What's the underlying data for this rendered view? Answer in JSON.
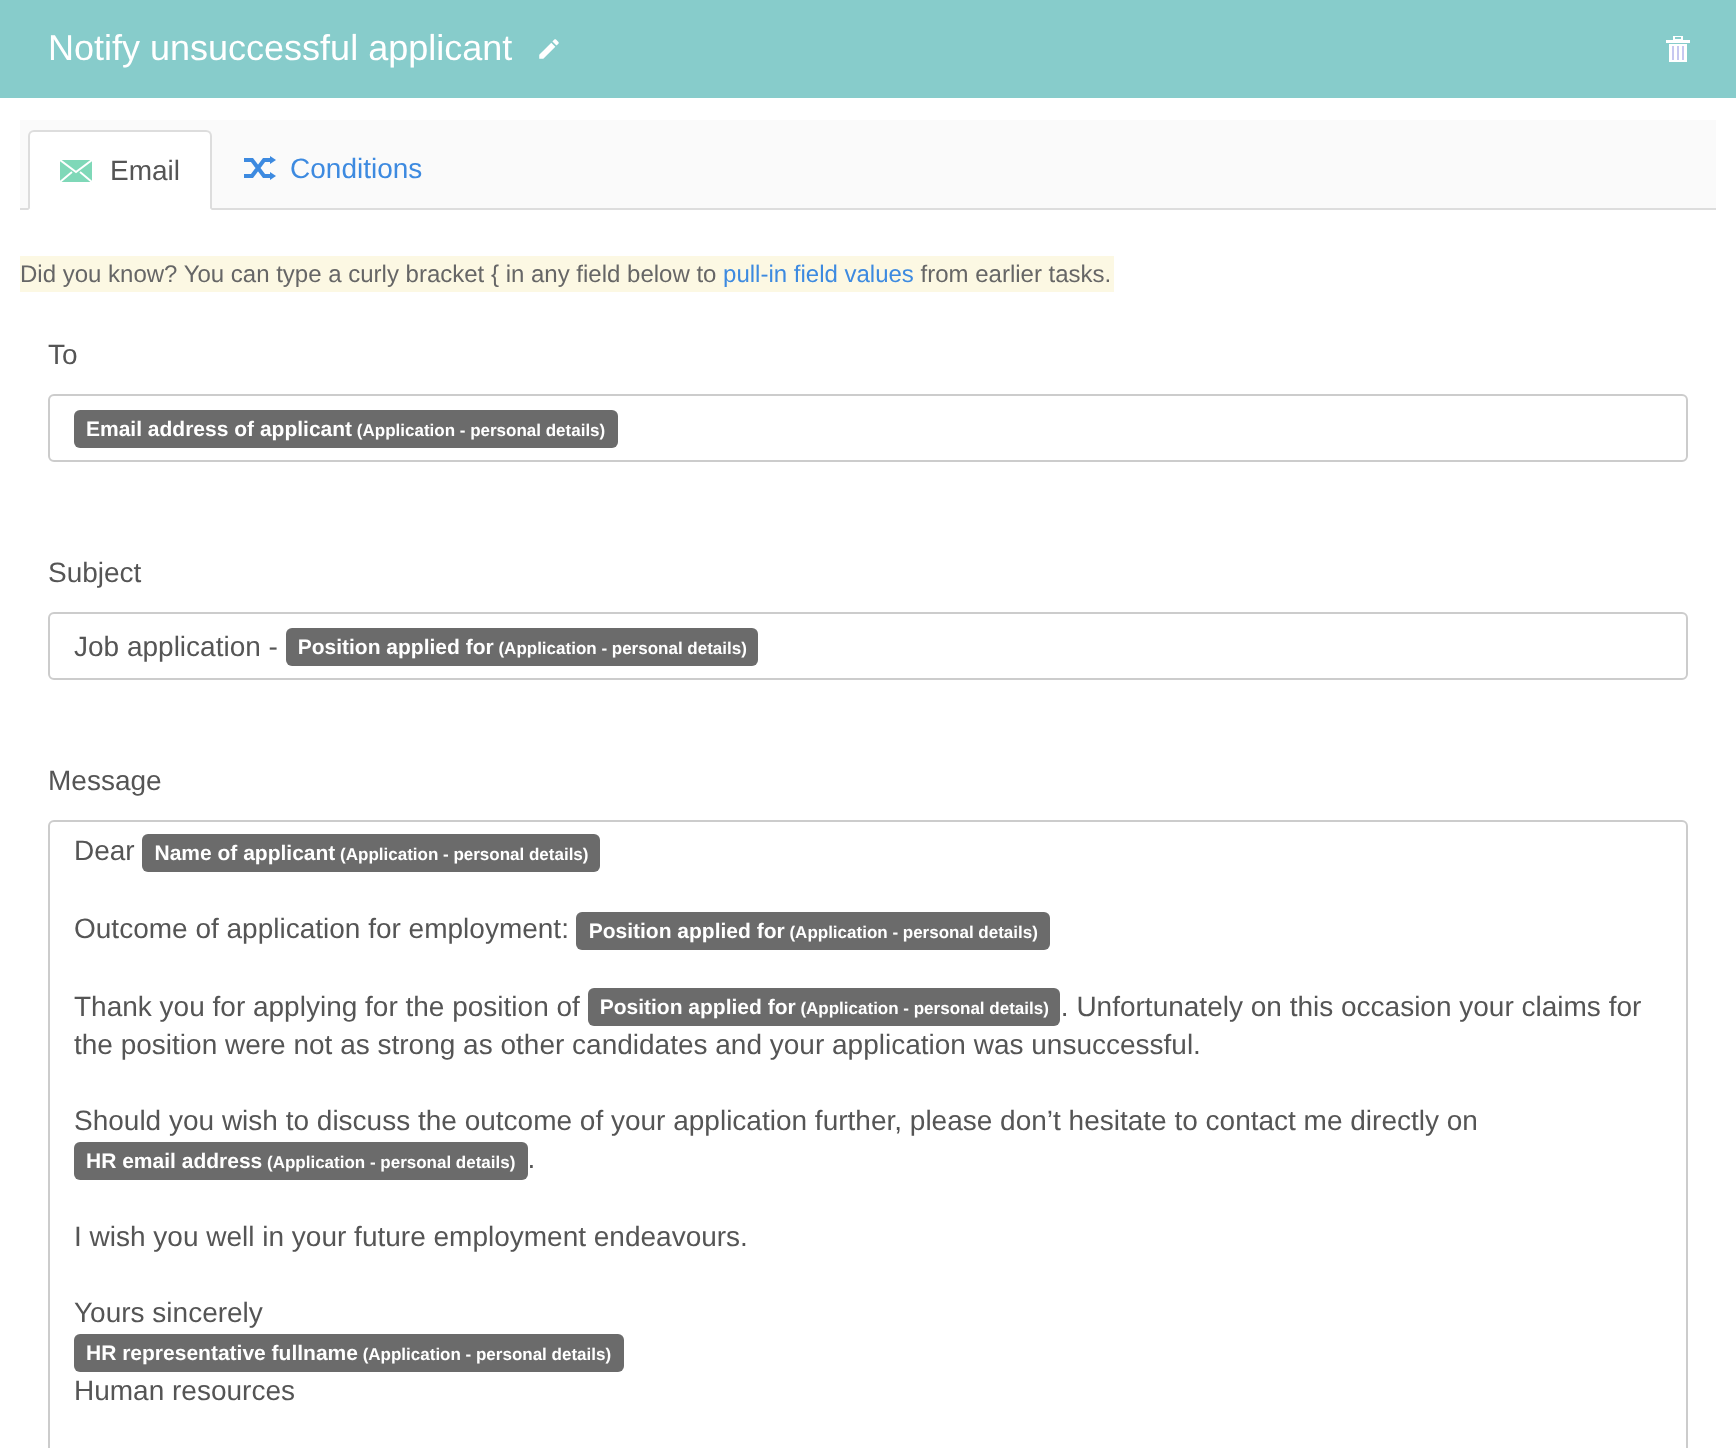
{
  "header": {
    "title": "Notify unsuccessful applicant"
  },
  "tabs": [
    {
      "label": "Email",
      "selected": true
    },
    {
      "label": "Conditions",
      "selected": false
    }
  ],
  "hint": {
    "before": "Did you know? You can type a curly bracket { in any field below to ",
    "link": "pull-in field values",
    "after": " from earlier tasks."
  },
  "fields": [
    {
      "label": "To",
      "segments": [
        {
          "kind": "token",
          "field": "Email address of applicant",
          "source": "(Application - personal details)"
        }
      ]
    },
    {
      "label": "Subject",
      "segments": [
        {
          "kind": "text",
          "text": "Job application - "
        },
        {
          "kind": "token",
          "field": "Position applied for",
          "source": "(Application - personal details)"
        }
      ]
    }
  ],
  "message": {
    "label": "Message",
    "paragraphs": [
      {
        "lines": [
          [
            {
              "kind": "text",
              "text": "Dear "
            },
            {
              "kind": "token",
              "field": "Name of applicant",
              "source": "(Application - personal details)"
            }
          ]
        ]
      },
      {
        "lines": [
          [
            {
              "kind": "text",
              "text": "Outcome of application for employment: "
            },
            {
              "kind": "token",
              "field": "Position applied for",
              "source": "(Application - personal details)"
            }
          ]
        ]
      },
      {
        "lines": [
          [
            {
              "kind": "text",
              "text": "Thank you for applying for the position of "
            },
            {
              "kind": "token",
              "field": "Position applied for",
              "source": "(Application - personal details)"
            },
            {
              "kind": "text",
              "text": ". Unfortunately on this occasion your claims for"
            }
          ],
          [
            {
              "kind": "text",
              "text": "the position were not as strong as other candidates and your application was unsuccessful."
            }
          ]
        ]
      },
      {
        "lines": [
          [
            {
              "kind": "text",
              "text": "Should you wish to discuss the outcome of your application further, please don’t hesitate to contact me directly on"
            }
          ],
          [
            {
              "kind": "token",
              "field": "HR email address",
              "source": "(Application - personal details)"
            },
            {
              "kind": "text",
              "text": "."
            }
          ]
        ]
      },
      {
        "lines": [
          [
            {
              "kind": "text",
              "text": "I wish you well in your future employment endeavours."
            }
          ]
        ]
      },
      {
        "lines": [
          [
            {
              "kind": "text",
              "text": "Yours sincerely"
            }
          ],
          [
            {
              "kind": "token",
              "field": "HR representative fullname",
              "source": "(Application - personal details)"
            }
          ],
          [
            {
              "kind": "text",
              "text": "Human resources"
            }
          ]
        ]
      }
    ]
  }
}
